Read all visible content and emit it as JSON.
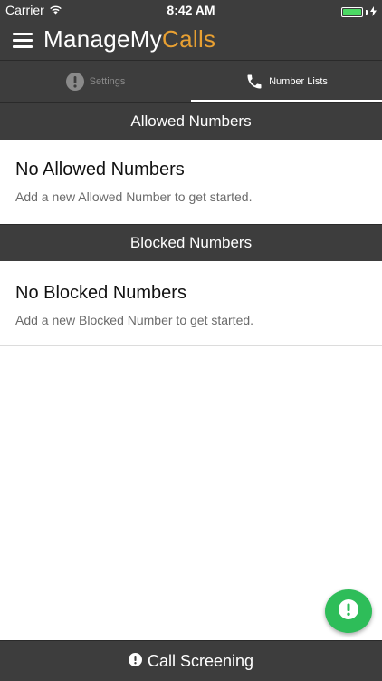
{
  "status_bar": {
    "carrier": "Carrier",
    "time": "8:42 AM",
    "battery_level": 1.0
  },
  "app_bar": {
    "brand_part1": "ManageMy",
    "brand_part2": "Calls",
    "brand_accent_color": "#e8a032"
  },
  "tabs": [
    {
      "label": "Settings",
      "icon": "alert-circle-icon",
      "active": false
    },
    {
      "label": "Number Lists",
      "icon": "phone-icon",
      "active": true
    }
  ],
  "allowed": {
    "header": "Allowed Numbers",
    "empty_title": "No Allowed Numbers",
    "empty_desc": "Add a new Allowed Number to get started."
  },
  "blocked": {
    "header": "Blocked Numbers",
    "empty_title": "No Blocked Numbers",
    "empty_desc": "Add a new Blocked Number to get started."
  },
  "fab": {
    "icon": "alert-circle-icon",
    "color": "#2ebd59"
  },
  "bottom_bar": {
    "label": "Call Screening",
    "icon": "alert-circle-icon"
  }
}
